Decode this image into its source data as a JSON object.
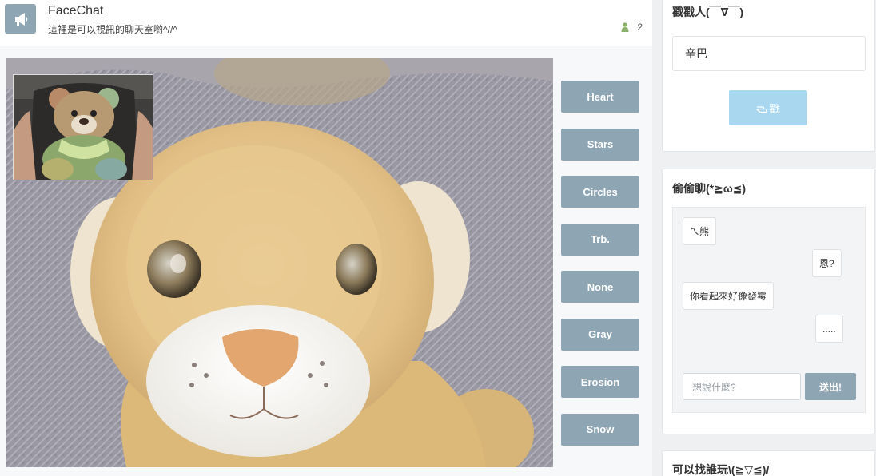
{
  "header": {
    "title": "FaceChat",
    "subtitle": "這裡是可以視訊的聊天室喲^//^",
    "user_count": "2",
    "icon": "megaphone-icon"
  },
  "filters": [
    {
      "label": "Heart"
    },
    {
      "label": "Stars"
    },
    {
      "label": "Circles"
    },
    {
      "label": "Trb."
    },
    {
      "label": "None"
    },
    {
      "label": "Gray"
    },
    {
      "label": "Erosion"
    },
    {
      "label": "Snow"
    }
  ],
  "poke": {
    "title": "戳戳人(￣∇￣)",
    "target": "辛巴",
    "button_label": "戳",
    "button_icon": "hand-point-icon"
  },
  "chat": {
    "title": "偷偷聊(*≧ω≦)",
    "messages": [
      {
        "text": "ㄟ熊",
        "side": "left"
      },
      {
        "text": "恩?",
        "side": "right"
      },
      {
        "text": "你看起來好像發霉",
        "side": "left"
      },
      {
        "text": ".....",
        "side": "right"
      }
    ],
    "input_placeholder": "想說什麼?",
    "send_label": "送出!"
  },
  "find": {
    "title": "可以找誰玩\\(≧▽≦)/"
  },
  "colors": {
    "accent": "#8ea5b4",
    "poke_button": "#a9d7f0",
    "user_icon": "#8bb06a"
  }
}
